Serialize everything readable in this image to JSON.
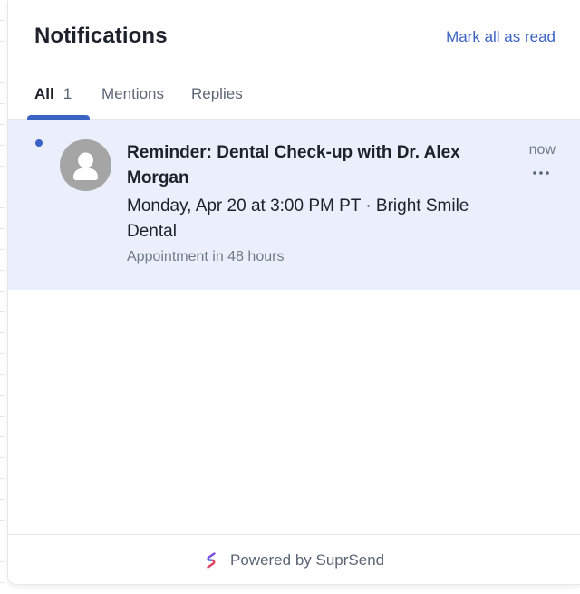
{
  "header": {
    "title": "Notifications",
    "mark_all_read": "Mark all as read"
  },
  "tabs": [
    {
      "label": "All",
      "count": "1",
      "active": true
    },
    {
      "label": "Mentions",
      "active": false
    },
    {
      "label": "Replies",
      "active": false
    }
  ],
  "notifications": [
    {
      "unread": true,
      "avatar_icon": "user-avatar-icon",
      "subject": "Reminder: Dental Check-up with Dr. Alex Morgan",
      "body": "Monday, Apr 20 at 3:00 PM PT · Bright Smile Dental",
      "meta": "Appointment in 48 hours",
      "time": "now",
      "more_icon": "more-horizontal-icon"
    }
  ],
  "footer": {
    "powered_by": "Powered by SuprSend",
    "logo_icon": "suprsend-logo-icon"
  },
  "colors": {
    "accent": "#3b63c4",
    "unread_background": "#eaeffb",
    "text_primary": "#1d2129",
    "text_secondary": "#737b87"
  }
}
